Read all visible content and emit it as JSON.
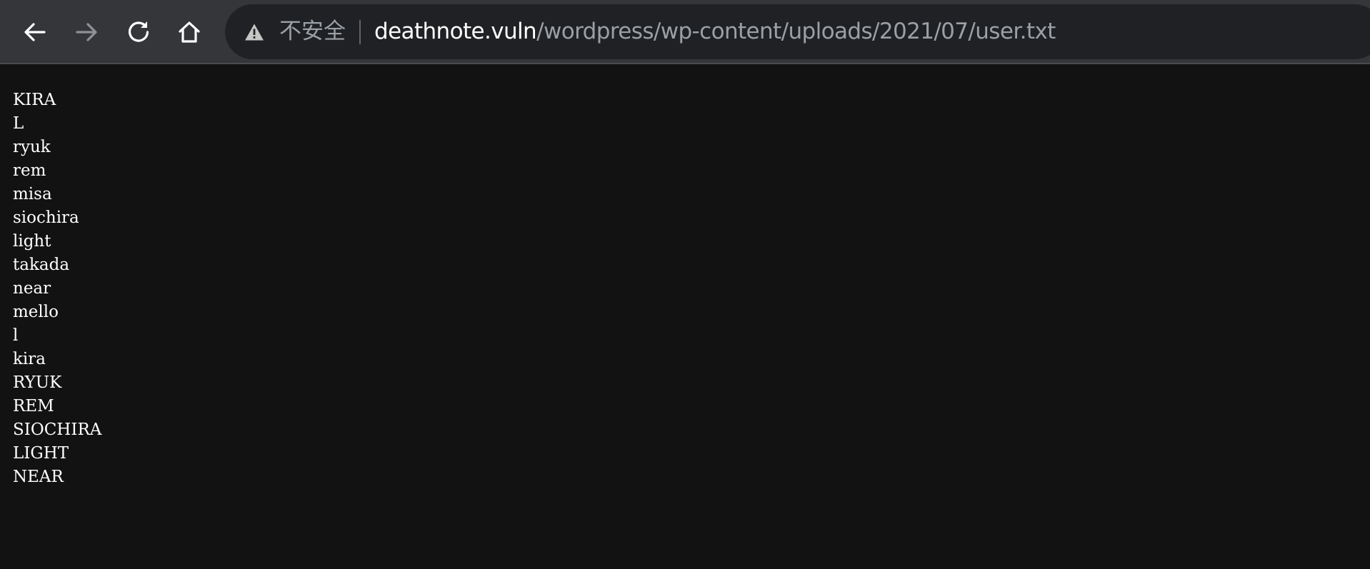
{
  "browser": {
    "nav": {
      "back_icon": "arrow-left-icon",
      "forward_icon": "arrow-right-icon",
      "reload_icon": "reload-icon",
      "home_icon": "home-icon"
    },
    "omnibox": {
      "security_icon": "warning-triangle-icon",
      "security_label": "不安全",
      "url_host": "deathnote.vuln",
      "url_path": "/wordpress/wp-content/uploads/2021/07/user.txt"
    },
    "colors": {
      "toolbar_bg": "#35363a",
      "omnibox_bg": "#202124",
      "page_bg": "#121212",
      "text": "#ffffff",
      "muted": "#9aa0a6"
    }
  },
  "document": {
    "lines": [
      "KIRA",
      "L",
      "ryuk",
      "rem",
      "misa",
      "siochira",
      "light",
      "takada",
      "near",
      "mello",
      "l",
      "kira",
      "RYUK",
      "REM",
      "SIOCHIRA",
      "LIGHT",
      "NEAR"
    ]
  }
}
